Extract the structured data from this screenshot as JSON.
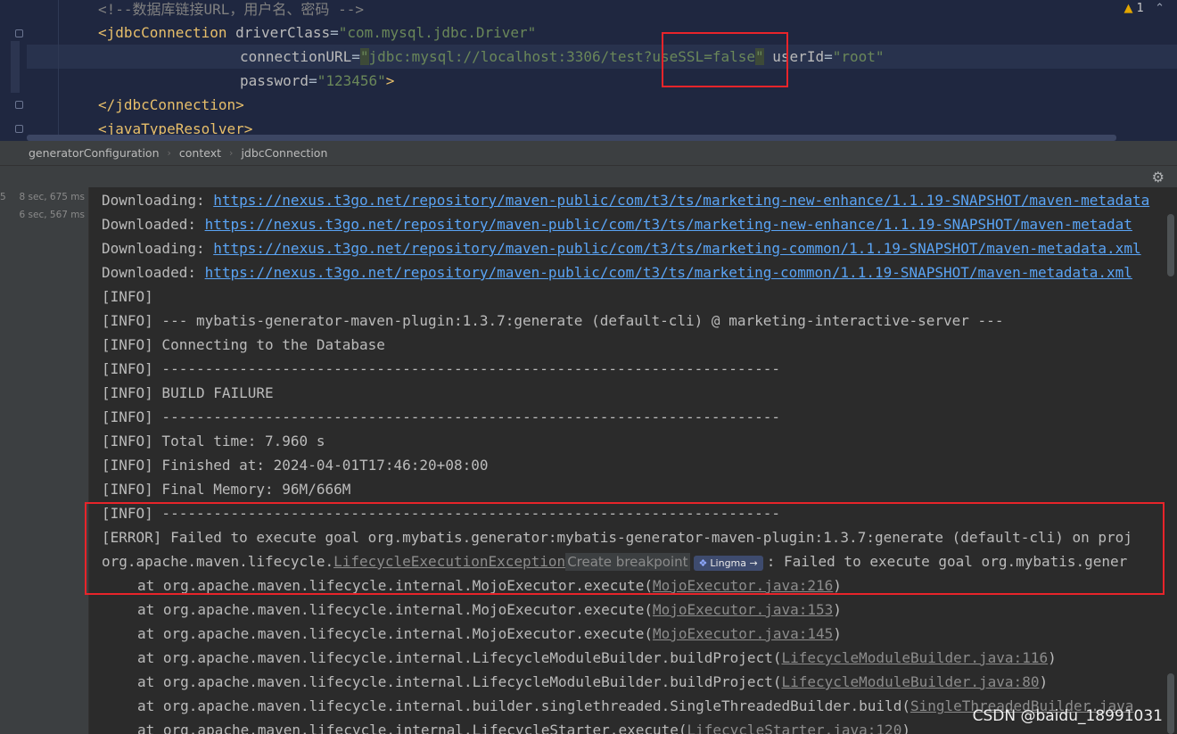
{
  "editor": {
    "warning": {
      "icon": "warning-triangle-icon",
      "count": "1"
    },
    "lines": {
      "l1": {
        "comment": "<!--数据库链接URL，用户名、密码 -->"
      },
      "l2": {
        "tag_open": "<jdbcConnection",
        "attr": "driverClass",
        "eq": "=",
        "value": "\"com.mysql.jdbc.Driver\""
      },
      "l3": {
        "attr": "connectionURL",
        "eq": "=",
        "quote_open": "\"",
        "value": "jdbc:mysql://localhost:3306/test?useSSL=false",
        "quote_close": "\"",
        "attr2": "userId",
        "eq2": "=",
        "value2": "\"root\""
      },
      "l4": {
        "attr": "password",
        "eq": "=",
        "value": "\"123456\"",
        "close": ">"
      },
      "l5": {
        "tag": "</jdbcConnection>"
      },
      "l6": {
        "tag": "<javaTypeResolver>"
      }
    }
  },
  "breadcrumb": [
    "generatorConfiguration",
    "context",
    "jdbcConnection"
  ],
  "tree": [
    {
      "num": "5",
      "time": "8 sec, 675 ms"
    },
    {
      "num": "",
      "time": "6 sec, 567 ms"
    }
  ],
  "console": {
    "downloads": [
      {
        "prefix": "Downloading: ",
        "url": "https://nexus.t3go.net/repository/maven-public/com/t3/ts/marketing-new-enhance/1.1.19-SNAPSHOT/maven-metadata"
      },
      {
        "prefix": "Downloaded: ",
        "url": "https://nexus.t3go.net/repository/maven-public/com/t3/ts/marketing-new-enhance/1.1.19-SNAPSHOT/maven-metadat"
      },
      {
        "prefix": "Downloading: ",
        "url": "https://nexus.t3go.net/repository/maven-public/com/t3/ts/marketing-common/1.1.19-SNAPSHOT/maven-metadata.xml"
      },
      {
        "prefix": "Downloaded: ",
        "url": "https://nexus.t3go.net/repository/maven-public/com/t3/ts/marketing-common/1.1.19-SNAPSHOT/maven-metadata.xml"
      }
    ],
    "info": [
      "[INFO]",
      "[INFO] --- mybatis-generator-maven-plugin:1.3.7:generate (default-cli) @ marketing-interactive-server ---",
      "[INFO] Connecting to the Database",
      "[INFO] ------------------------------------------------------------------------",
      "[INFO] BUILD FAILURE",
      "[INFO] ------------------------------------------------------------------------",
      "[INFO] Total time: 7.960 s",
      "[INFO] Finished at: 2024-04-01T17:46:20+08:00",
      "[INFO] Final Memory: 96M/666M",
      "[INFO] ------------------------------------------------------------------------"
    ],
    "error": "[ERROR] Failed to execute goal org.mybatis.generator:mybatis-generator-maven-plugin:1.3.7:generate (default-cli) on proj",
    "exception": {
      "prefix": "org.apache.maven.lifecycle.",
      "link": "LifecycleExecutionException",
      "hint": "Create breakpoint",
      "lingma": "Lingma",
      "lingma_arrow": "→",
      "suffix": ": Failed to execute goal org.mybatis.gener"
    },
    "stack": [
      {
        "text": "at org.apache.maven.lifecycle.internal.MojoExecutor.execute(",
        "file": "MojoExecutor.java:216",
        "close": ")"
      },
      {
        "text": "at org.apache.maven.lifecycle.internal.MojoExecutor.execute(",
        "file": "MojoExecutor.java:153",
        "close": ")"
      },
      {
        "text": "at org.apache.maven.lifecycle.internal.MojoExecutor.execute(",
        "file": "MojoExecutor.java:145",
        "close": ")"
      },
      {
        "text": "at org.apache.maven.lifecycle.internal.LifecycleModuleBuilder.buildProject(",
        "file": "LifecycleModuleBuilder.java:116",
        "close": ")"
      },
      {
        "text": "at org.apache.maven.lifecycle.internal.LifecycleModuleBuilder.buildProject(",
        "file": "LifecycleModuleBuilder.java:80",
        "close": ")"
      },
      {
        "text": "at org.apache.maven.lifecycle.internal.builder.singlethreaded.SingleThreadedBuilder.build(",
        "file": "SingleThreadedBuilder.java",
        "close": ""
      },
      {
        "text": "at org.apache.maven.lifecycle.internal.LifecycleStarter.execute(",
        "file": "LifecycleStarter.java:120",
        "close": ")"
      }
    ]
  },
  "watermark": "CSDN @baidu_18991031",
  "colors": {
    "annotation_red": "#e8242a",
    "link_blue": "#5aa4f5",
    "tag_yellow": "#e8bf6a",
    "string_green": "#6a8759"
  }
}
